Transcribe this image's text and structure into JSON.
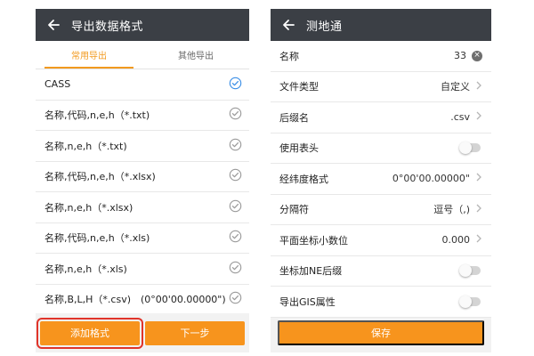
{
  "left": {
    "title": "导出数据格式",
    "tabs": [
      {
        "label": "常用导出",
        "active": true
      },
      {
        "label": "其他导出",
        "active": false
      }
    ],
    "formats": [
      {
        "label": "CASS",
        "checked": true
      },
      {
        "label": "名称,代码,n,e,h（*.txt)",
        "checked": false
      },
      {
        "label": "名称,n,e,h（*.txt)",
        "checked": false
      },
      {
        "label": "名称,代码,n,e,h（*.xlsx)",
        "checked": false
      },
      {
        "label": "名称,n,e,h（*.xlsx)",
        "checked": false
      },
      {
        "label": "名称,代码,n,e,h（*.xls)",
        "checked": false
      },
      {
        "label": "名称,n,e,h（*.xls)",
        "checked": false
      },
      {
        "label": "名称,B,L,H（*.csv)　(0°00'00.00000\")",
        "checked": false
      }
    ],
    "add_label": "添加格式",
    "next_label": "下一步"
  },
  "right": {
    "title": "测地通",
    "fields": [
      {
        "label": "名称",
        "value": "33",
        "control": "clear"
      },
      {
        "label": "文件类型",
        "value": "自定义",
        "control": "chevron"
      },
      {
        "label": "后缀名",
        "value": ".csv",
        "control": "chevron"
      },
      {
        "label": "使用表头",
        "value": "",
        "control": "toggle"
      },
      {
        "label": "经纬度格式",
        "value": "0°00'00.00000\"",
        "control": "chevron"
      },
      {
        "label": "分隔符",
        "value": "逗号（,)",
        "control": "chevron"
      },
      {
        "label": "平面坐标小数位",
        "value": "0.000",
        "control": "chevron"
      },
      {
        "label": "坐标加NE后缀",
        "value": "",
        "control": "toggle"
      },
      {
        "label": "导出GIS属性",
        "value": "",
        "control": "toggle"
      }
    ],
    "save_label": "保存"
  },
  "colors": {
    "appbar": "#3b3f45",
    "accent": "#f7941d",
    "check_active": "#3a8ee6",
    "check_inactive": "#9a9a9a",
    "highlight_box": "#e0342a"
  }
}
